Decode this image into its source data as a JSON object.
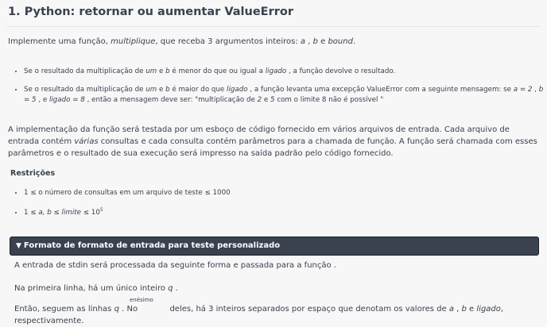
{
  "title": "1. Python: retornar ou aumentar ValueError",
  "intro": {
    "t1": "Implemente uma função, ",
    "fn": "multiplique",
    "t2": ", que receba 3 argumentos inteiros: ",
    "a": "a",
    "sep": " , ",
    "b": "b",
    "and": " e ",
    "bound": "bound",
    "end": "."
  },
  "bullets": [
    {
      "t1": "Se o resultado da multiplicação de ",
      "um": "um",
      "e": " e ",
      "b": "b",
      "t2": " é menor do que ou igual a ",
      "ligado": "ligado",
      "t3": " , a função devolve o resultado."
    },
    {
      "t1": "Se o resultado da multiplicação de ",
      "um": "um",
      "e": " e ",
      "b": "b",
      "t2": " é maior do que ",
      "ligado": "ligado",
      "t3": " , a função levanta uma excepção ValueError com a seguinte mensagem: se ",
      "a2": "a = 2",
      "comma": " , ",
      "b5": "b = 5",
      "e2": " , e ",
      "lig8": "ligado = 8",
      "t4": " , então a mensagem deve ser: \"multiplicação de ",
      "n2": "2",
      "e3": " e ",
      "n5": "5",
      "t5": " com o limite 8 não é possível \""
    }
  ],
  "body": {
    "t1": "A implementação da função será testada por um esboço de código fornecido em vários arquivos de entrada. Cada arquivo de entrada contém ",
    "varias": "várias",
    "t2": " consultas e cada consulta contém parâmetros para a chamada de função. A função será chamada com esses parâmetros e o resultado de sua execução será impresso na saída padrão pelo código fornecido."
  },
  "restricoes": {
    "title": "Restrições",
    "r1": "1 ≤ o número de consultas em um arquivo de teste ≤ 1000",
    "r2_pre": "1 ≤ ",
    "r2_vars": "a, b",
    "r2_le": " ≤ ",
    "r2_lim": "limite",
    "r2_post": " ≤ 10",
    "r2_exp": "5"
  },
  "section": {
    "label": "Formato de formato de entrada para teste personalizado"
  },
  "lines": {
    "l1": "A entrada de stdin será processada da seguinte forma e passada para a função .",
    "l2_pre": "Na primeira linha, há um único inteiro ",
    "l2_q": "q",
    "l2_end": " .",
    "enesimo": "enésimo",
    "l3_pre": "Então, seguem as linhas ",
    "l3_q": "q",
    "l3_mid": " . No ",
    "l3_post": " deles, há 3 inteiros separados por espaço que denotam os valores de ",
    "l3_a": "a",
    "l3_c": " , ",
    "l3_b": "b",
    "l3_e": " e ",
    "l3_lig": "ligado",
    "l3_end": ", respectivamente."
  }
}
